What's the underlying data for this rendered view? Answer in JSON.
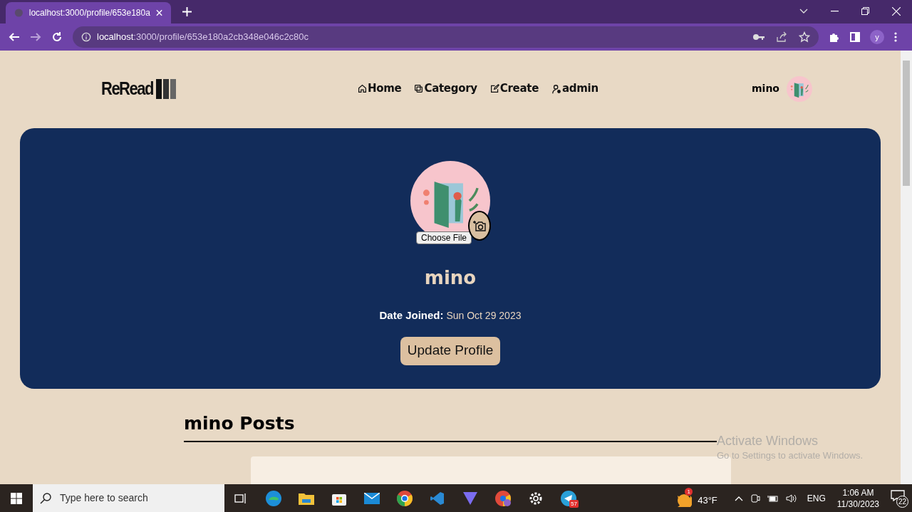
{
  "browser": {
    "tab_title": "localhost:3000/profile/653e180a",
    "url_host": "localhost",
    "url_path": ":3000/profile/653e180a2cb348e046c2c80c",
    "profile_initial": "y"
  },
  "nav": {
    "logo": "ReRead",
    "links": [
      {
        "label": "Home"
      },
      {
        "label": "Category"
      },
      {
        "label": "Create"
      },
      {
        "label": "admin"
      }
    ],
    "user": "mino"
  },
  "profile": {
    "choose_file": "Choose File",
    "name": "mino",
    "date_label": "Date Joined:",
    "date": "Sun Oct 29 2023",
    "button": "Update Profile"
  },
  "posts_heading": "mino Posts",
  "activation": {
    "title": "Activate Windows",
    "subtitle": "Go to Settings to activate Windows."
  },
  "taskbar": {
    "search_placeholder": "Type here to search",
    "weather_badge": "1",
    "temperature": "43°F",
    "telegram_badge": "57",
    "language": "ENG",
    "time": "1:06 AM",
    "date": "11/30/2023",
    "notifications": "22"
  }
}
